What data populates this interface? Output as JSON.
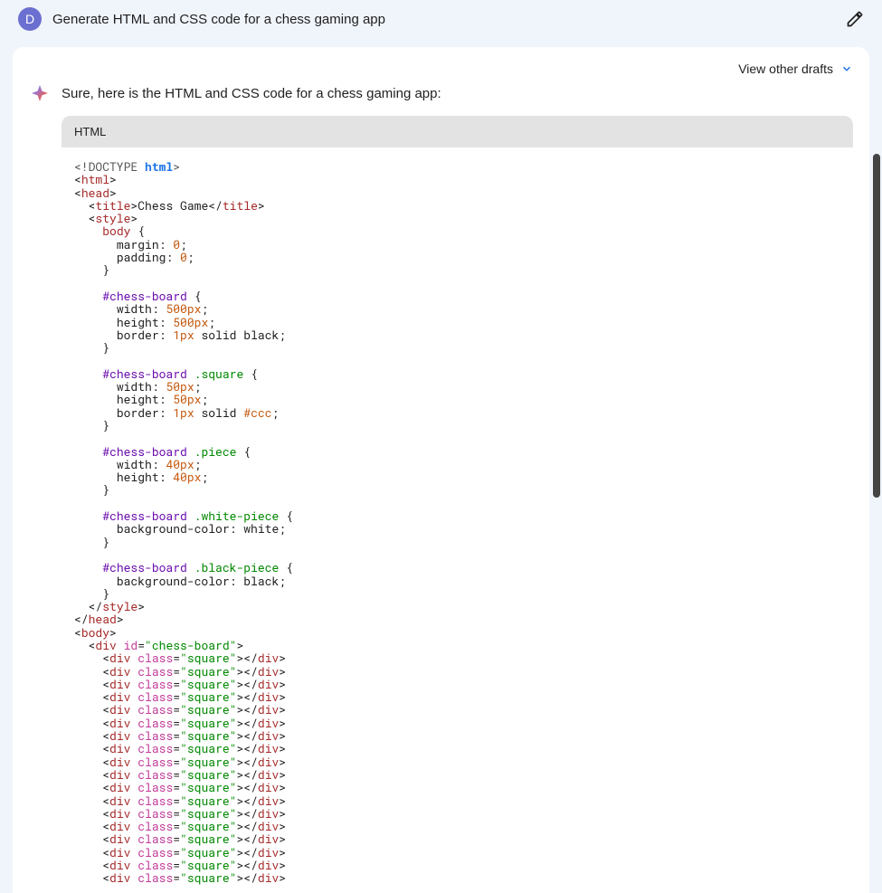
{
  "prompt": {
    "avatar_letter": "D",
    "text": "Generate HTML and CSS code for a chess gaming app"
  },
  "header": {
    "view_drafts": "View other drafts"
  },
  "response": {
    "intro": "Sure, here is the HTML and CSS code for a chess gaming app:",
    "code_label": "HTML",
    "code": {
      "doctype": "<!DOCTYPE ",
      "doctype_kw": "html",
      "doctype_close": ">",
      "html_open": "html",
      "head_open": "head",
      "title_tag": "title",
      "title_text": "Chess Game",
      "style_tag": "style",
      "body_sel": "body",
      "margin_prop": "margin",
      "zero": "0",
      "padding_prop": "padding",
      "board_sel": "#chess-board",
      "width_prop": "width",
      "height_prop": "height",
      "border_prop": "border",
      "bg_prop": "background-color",
      "px500": "500px",
      "px50": "50px",
      "px40": "40px",
      "px1": "1px",
      "solid": "solid",
      "black": "black",
      "white": "white",
      "ccc": "#ccc",
      "square_cls": ".square",
      "piece_cls": ".piece",
      "white_piece_cls": ".white-piece",
      "black_piece_cls": ".black-piece",
      "body_tag": "body",
      "div_tag": "div",
      "id_attr": "id",
      "class_attr": "class",
      "board_id_val": "\"chess-board\"",
      "square_cls_val": "\"square\""
    }
  }
}
